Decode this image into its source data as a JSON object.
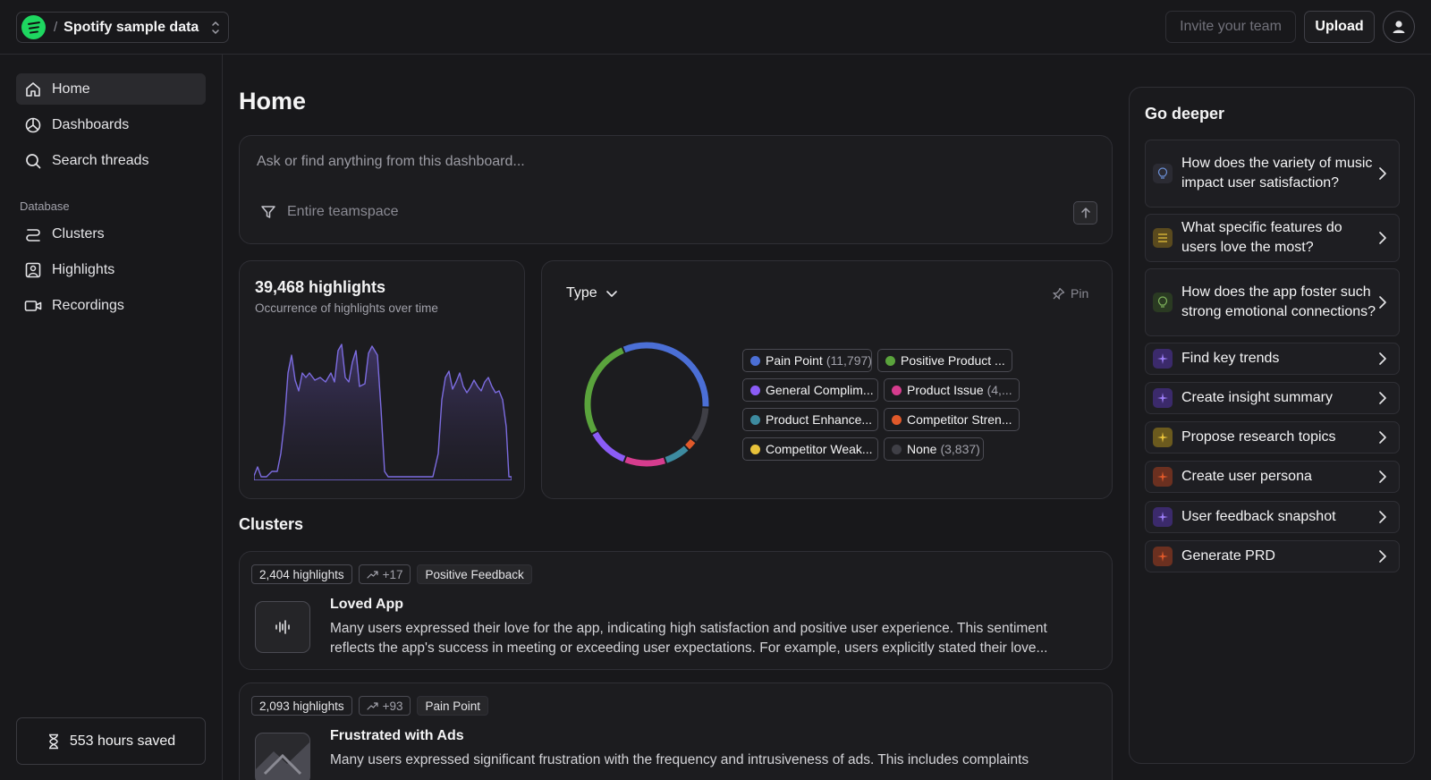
{
  "workspace": {
    "name": "Spotify sample data",
    "separator": "/"
  },
  "header": {
    "invite_label": "Invite your team",
    "upload_label": "Upload"
  },
  "sidebar": {
    "items": [
      {
        "label": "Home",
        "icon": "home-icon"
      },
      {
        "label": "Dashboards",
        "icon": "pie-chart-icon"
      },
      {
        "label": "Search threads",
        "icon": "search-icon"
      }
    ],
    "section_label": "Database",
    "db_items": [
      {
        "label": "Clusters",
        "icon": "clusters-icon"
      },
      {
        "label": "Highlights",
        "icon": "highlight-icon"
      },
      {
        "label": "Recordings",
        "icon": "video-camera-icon"
      }
    ],
    "hours_saved": "553 hours saved"
  },
  "main": {
    "title": "Home",
    "ask": {
      "placeholder": "Ask or find anything from this dashboard...",
      "scope": "Entire teamspace"
    },
    "highlights_card": {
      "title": "39,468 highlights",
      "subtitle": "Occurrence of highlights over time"
    },
    "type_card": {
      "dropdown_label": "Type",
      "pin_label": "Pin",
      "legend": [
        {
          "label": "Pain Point",
          "count": "(11,797)",
          "color": "#4b6fd6"
        },
        {
          "label": "Positive Product ...",
          "count": "",
          "color": "#5aa33c"
        },
        {
          "label": "General Complim...",
          "count": "",
          "color": "#8b5cf6"
        },
        {
          "label": "Product Issue",
          "count": "(4,...",
          "color": "#d63c8e"
        },
        {
          "label": "Product Enhance...",
          "count": "",
          "color": "#3d8ba0"
        },
        {
          "label": "Competitor Stren...",
          "count": "",
          "color": "#e0592a"
        },
        {
          "label": "Competitor Weak...",
          "count": "",
          "color": "#e8c23a"
        },
        {
          "label": "None",
          "count": "(3,837)",
          "color": "#3f3f46"
        }
      ]
    },
    "clusters_title": "Clusters",
    "clusters": [
      {
        "count": "2,404 highlights",
        "trend": "+17",
        "category": "Positive Feedback",
        "title": "Loved App",
        "desc_line1": "Many users expressed their love for the app, indicating high satisfaction and positive user experience. This sentiment",
        "desc_line2": "reflects the app's success in meeting or exceeding user expectations. For example, users explicitly stated their love..."
      },
      {
        "count": "2,093 highlights",
        "trend": "+93",
        "category": "Pain Point",
        "title": "Frustrated with Ads",
        "desc_line1": "Many users expressed significant frustration with the frequency and intrusiveness of ads. This includes complaints",
        "desc_line2": ""
      }
    ]
  },
  "deeper": {
    "title": "Go deeper",
    "items": [
      {
        "label": "How does the variety of music impact user satisfaction?",
        "icon": "lightbulb-icon",
        "color": "#2b2b33"
      },
      {
        "label": "What specific features do users love the most?",
        "icon": "list-icon",
        "color": "#5a4a1e"
      },
      {
        "label": "How does the app foster such strong emotional connections?",
        "icon": "lightbulb-icon",
        "color": "#2a3a22"
      },
      {
        "label": "Find key trends",
        "icon": "sparkle-icon",
        "color": "#3b2a6b"
      },
      {
        "label": "Create insight summary",
        "icon": "sparkle-icon",
        "color": "#3b2a6b"
      },
      {
        "label": "Propose research topics",
        "icon": "sparkle-icon",
        "color": "#6b5a1e"
      },
      {
        "label": "Create user persona",
        "icon": "sparkle-icon",
        "color": "#6b3020"
      },
      {
        "label": "User feedback snapshot",
        "icon": "sparkle-icon",
        "color": "#3b2a6b"
      },
      {
        "label": "Generate PRD",
        "icon": "sparkle-icon",
        "color": "#6b3020"
      }
    ]
  }
}
